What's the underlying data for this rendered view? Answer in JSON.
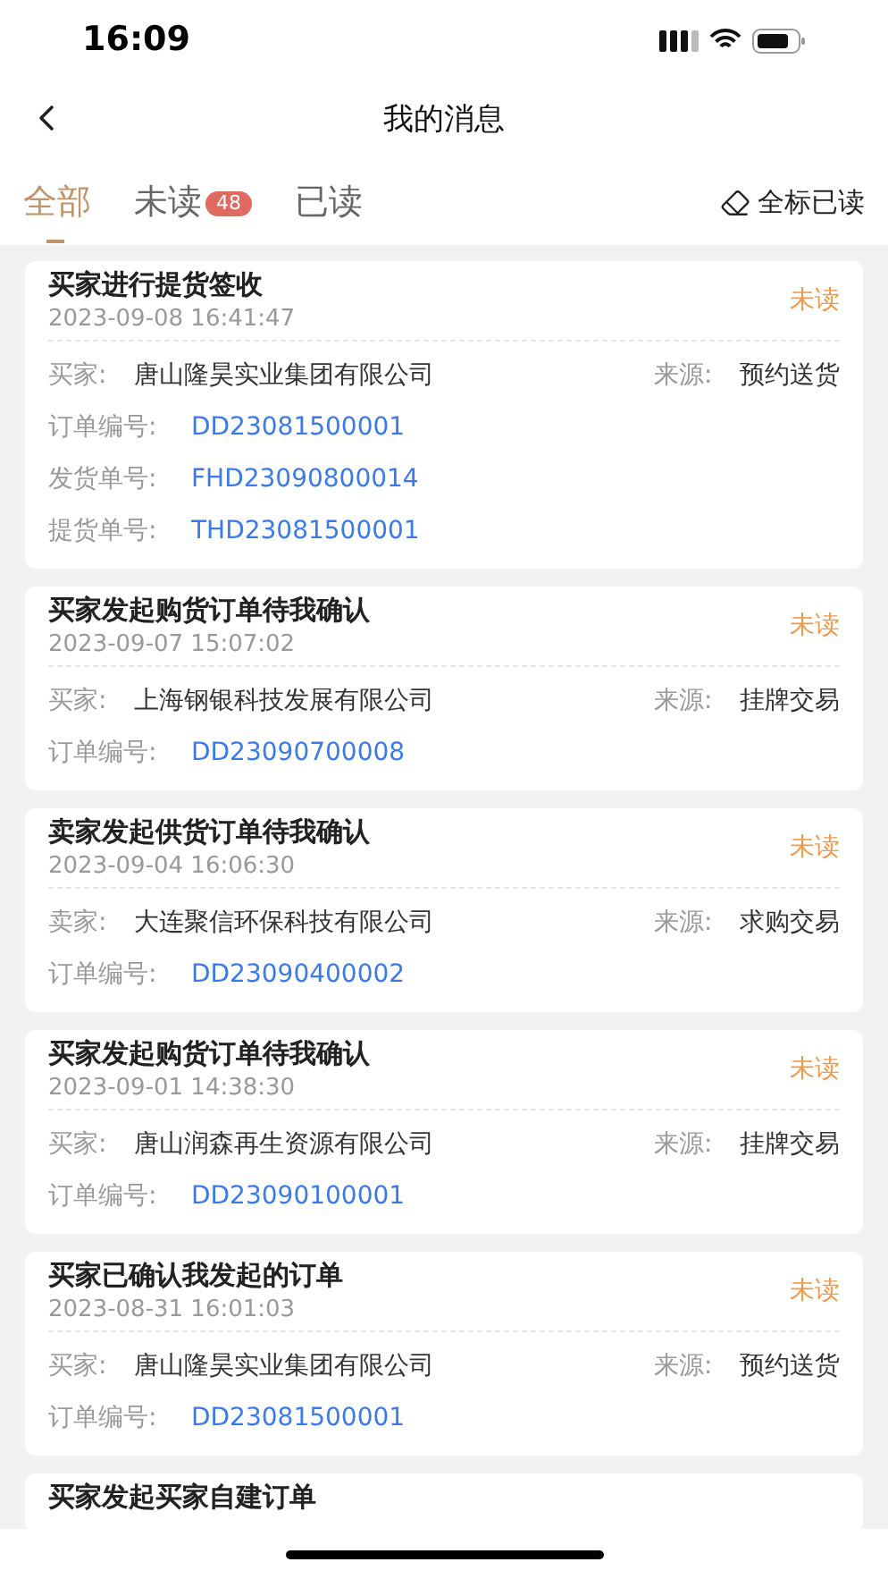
{
  "status_bar": {
    "time": "16:09"
  },
  "nav": {
    "title": "我的消息"
  },
  "tabs": [
    {
      "label": "全部",
      "selected": true
    },
    {
      "label": "未读",
      "badge": "48",
      "selected": false
    },
    {
      "label": "已读",
      "selected": false
    }
  ],
  "mark_all_read": "全标已读",
  "messages": [
    {
      "title": "买家进行提货签收",
      "time": "2023-09-08 16:41:47",
      "status": "未读",
      "unread": true,
      "party": {
        "label": "买家:",
        "value": "唐山隆昊实业集团有限公司"
      },
      "source": {
        "label": "来源:",
        "value": "预约送货"
      },
      "numbers": [
        {
          "label": "订单编号:",
          "value": "DD23081500001"
        },
        {
          "label": "发货单号:",
          "value": "FHD23090800014"
        },
        {
          "label": "提货单号:",
          "value": "THD23081500001"
        }
      ]
    },
    {
      "title": "买家发起购货订单待我确认",
      "time": "2023-09-07 15:07:02",
      "status": "未读",
      "unread": true,
      "party": {
        "label": "买家:",
        "value": "上海钢银科技发展有限公司"
      },
      "source": {
        "label": "来源:",
        "value": "挂牌交易"
      },
      "numbers": [
        {
          "label": "订单编号:",
          "value": "DD23090700008"
        }
      ]
    },
    {
      "title": "卖家发起供货订单待我确认",
      "time": "2023-09-04 16:06:30",
      "status": "未读",
      "unread": true,
      "party": {
        "label": "卖家:",
        "value": "大连聚信环保科技有限公司"
      },
      "source": {
        "label": "来源:",
        "value": "求购交易"
      },
      "numbers": [
        {
          "label": "订单编号:",
          "value": "DD23090400002"
        }
      ]
    },
    {
      "title": "买家发起购货订单待我确认",
      "time": "2023-09-01 14:38:30",
      "status": "未读",
      "unread": true,
      "party": {
        "label": "买家:",
        "value": "唐山润森再生资源有限公司"
      },
      "source": {
        "label": "来源:",
        "value": "挂牌交易"
      },
      "numbers": [
        {
          "label": "订单编号:",
          "value": "DD23090100001"
        }
      ]
    },
    {
      "title": "买家已确认我发起的订单",
      "time": "2023-08-31 16:01:03",
      "status": "未读",
      "unread": true,
      "party": {
        "label": "买家:",
        "value": "唐山隆昊实业集团有限公司"
      },
      "source": {
        "label": "来源:",
        "value": "预约送货"
      },
      "numbers": [
        {
          "label": "订单编号:",
          "value": "DD23081500001"
        }
      ]
    },
    {
      "title": "买家发起买家自建订单"
    }
  ]
}
